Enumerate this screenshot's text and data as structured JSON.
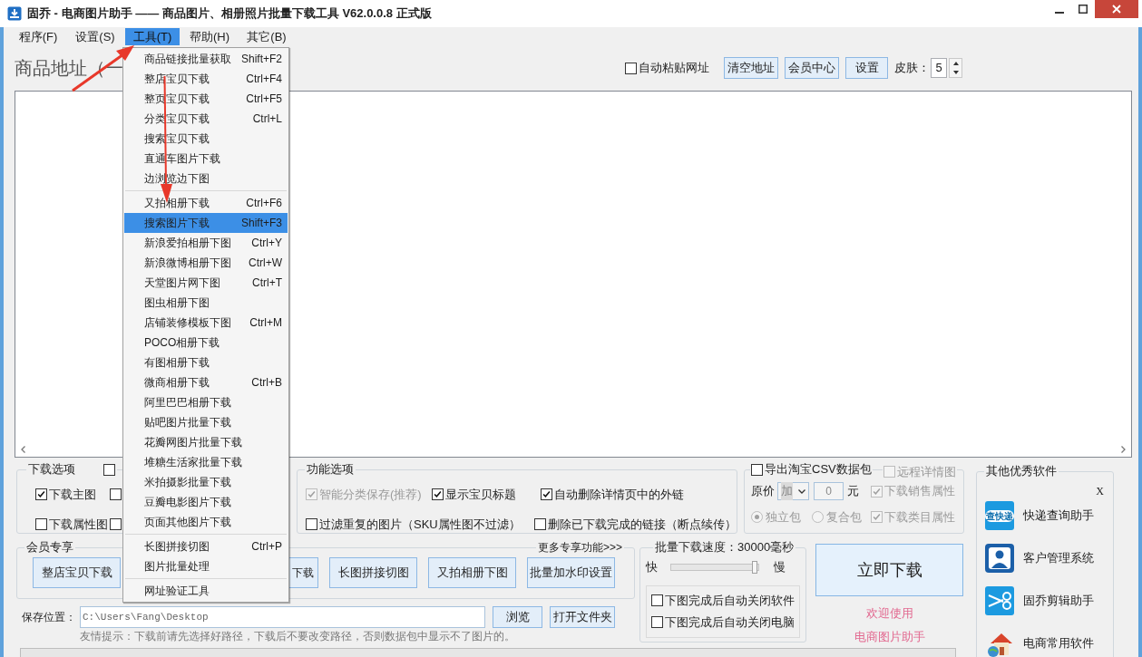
{
  "window": {
    "title": "固乔 - 电商图片助手 —— 商品图片、相册照片批量下载工具 V62.0.0.8 正式版"
  },
  "menubar": [
    {
      "label": "程序(F)",
      "selected": false
    },
    {
      "label": "设置(S)",
      "selected": false
    },
    {
      "label": "工具(T)",
      "selected": true
    },
    {
      "label": "帮助(H)",
      "selected": false
    },
    {
      "label": "其它(B)",
      "selected": false
    }
  ],
  "address": {
    "label": "商品地址（一"
  },
  "toolbar": {
    "auto_paste": {
      "label": "自动粘贴网址",
      "checked": false
    },
    "buttons": [
      "清空地址",
      "会员中心",
      "设置"
    ],
    "skin_label": "皮肤：",
    "skin_value": "5"
  },
  "download_options": {
    "title": "下载选项",
    "header_check": {
      "checked": false
    },
    "checks": [
      {
        "label": "下载主图",
        "checked": true
      },
      {
        "checked": false
      },
      {
        "label": "下载属性图",
        "checked": false
      },
      {
        "checked": false
      }
    ]
  },
  "feature_options": {
    "title": "功能选项",
    "checks": [
      {
        "label": "智能分类保存(推荐)",
        "checked": true,
        "disabled": true
      },
      {
        "label": "显示宝贝标题",
        "checked": true,
        "disabled": false
      },
      {
        "label": "自动删除详情页中的外链",
        "checked": true,
        "disabled": false
      },
      {
        "label": "过滤重复的图片（SKU属性图不过滤）",
        "checked": false,
        "disabled": false
      },
      {
        "label": "删除已下载完成的链接（断点续传）",
        "checked": false,
        "disabled": false
      }
    ]
  },
  "export": {
    "csv": {
      "label": "导出淘宝CSV数据包",
      "checked": false
    },
    "remote": {
      "label": "远程详情图",
      "checked": false,
      "disabled": true
    },
    "price_label": "原价",
    "price_op": "加",
    "price_value": "0",
    "unit": "元",
    "packs": [
      {
        "label": "独立包",
        "selected": true
      },
      {
        "label": "复合包",
        "selected": false
      }
    ],
    "attrs": [
      {
        "label": "下载销售属性",
        "checked": true,
        "disabled": true
      },
      {
        "label": "下载类目属性",
        "checked": true,
        "disabled": true
      }
    ]
  },
  "member": {
    "title": "会员专享",
    "more_link": "更多专享功能>>>",
    "buttons": [
      {
        "kind": "button",
        "label": "整店宝贝下载"
      },
      {
        "kind": "covered"
      },
      {
        "kind": "partial",
        "label": "下载"
      },
      {
        "kind": "button",
        "label": "长图拼接切图"
      },
      {
        "kind": "button",
        "label": "又拍相册下图"
      },
      {
        "kind": "button",
        "label": "批量加水印设置"
      }
    ]
  },
  "speed": {
    "label": "批量下载速度：30000毫秒",
    "fast": "快",
    "slow": "慢",
    "level": 0.97,
    "checks": [
      {
        "label": "下图完成后自动关闭软件",
        "checked": false
      },
      {
        "label": "下图完成后自动关闭电脑",
        "checked": false
      }
    ]
  },
  "download_button": "立即下载",
  "welcome": [
    "欢迎使用",
    "电商图片助手"
  ],
  "save": {
    "label": "保存位置：",
    "path": "C:\\Users\\Fang\\Desktop",
    "browse": "浏览",
    "open_folder": "打开文件夹"
  },
  "hint": "友情提示：下载前请先选择好路径，下载后不要改变路径，否则数据包中显示不了图片的。",
  "other_software": {
    "title": "其他优秀软件",
    "close": "X",
    "items": [
      {
        "kind": "express",
        "badge": "查快递",
        "label": "快递查询助手"
      },
      {
        "kind": "customer",
        "label": "客户管理系统"
      },
      {
        "kind": "scissors",
        "label": "固乔剪辑助手"
      },
      {
        "kind": "home",
        "label": "电商常用软件"
      }
    ]
  },
  "tools_menu": {
    "items": [
      {
        "kind": "item",
        "label": "商品链接批量获取",
        "shortcut": "Shift+F2",
        "selected": false
      },
      {
        "kind": "item",
        "label": "整店宝贝下载",
        "shortcut": "Ctrl+F4",
        "selected": false
      },
      {
        "kind": "item",
        "label": "整页宝贝下载",
        "shortcut": "Ctrl+F5",
        "selected": false
      },
      {
        "kind": "item",
        "label": "分类宝贝下载",
        "shortcut": "Ctrl+L",
        "selected": false
      },
      {
        "kind": "item",
        "label": "搜索宝贝下载",
        "selected": false
      },
      {
        "kind": "item",
        "label": "直通车图片下载",
        "selected": false
      },
      {
        "kind": "item",
        "label": "边浏览边下图",
        "selected": false
      },
      {
        "kind": "separator"
      },
      {
        "kind": "item",
        "label": "又拍相册下载",
        "shortcut": "Ctrl+F6",
        "selected": false
      },
      {
        "kind": "item",
        "label": "搜索图片下载",
        "shortcut": "Shift+F3",
        "selected": true
      },
      {
        "kind": "item",
        "label": "新浪爱拍相册下图",
        "shortcut": "Ctrl+Y",
        "selected": false
      },
      {
        "kind": "item",
        "label": "新浪微博相册下图",
        "shortcut": "Ctrl+W",
        "selected": false
      },
      {
        "kind": "item",
        "label": "天堂图片网下图",
        "shortcut": "Ctrl+T",
        "selected": false
      },
      {
        "kind": "item",
        "label": "图虫相册下图",
        "selected": false
      },
      {
        "kind": "item",
        "label": "店铺装修模板下图",
        "shortcut": "Ctrl+M",
        "selected": false
      },
      {
        "kind": "item",
        "label": "POCO相册下载",
        "selected": false
      },
      {
        "kind": "item",
        "label": "有图相册下载",
        "selected": false
      },
      {
        "kind": "item",
        "label": "微商相册下载",
        "shortcut": "Ctrl+B",
        "selected": false
      },
      {
        "kind": "item",
        "label": "阿里巴巴相册下载",
        "selected": false
      },
      {
        "kind": "item",
        "label": "贴吧图片批量下载",
        "selected": false
      },
      {
        "kind": "item",
        "label": "花瓣网图片批量下载",
        "selected": false
      },
      {
        "kind": "item",
        "label": "堆糖生活家批量下载",
        "selected": false
      },
      {
        "kind": "item",
        "label": "米拍摄影批量下载",
        "selected": false
      },
      {
        "kind": "item",
        "label": "豆瓣电影图片下载",
        "selected": false
      },
      {
        "kind": "item",
        "label": "页面其他图片下载",
        "selected": false
      },
      {
        "kind": "separator"
      },
      {
        "kind": "item",
        "label": "长图拼接切图",
        "shortcut": "Ctrl+P",
        "selected": false
      },
      {
        "kind": "item",
        "label": "图片批量处理",
        "selected": false
      },
      {
        "kind": "separator"
      },
      {
        "kind": "item",
        "label": "网址验证工具",
        "selected": false
      }
    ]
  }
}
